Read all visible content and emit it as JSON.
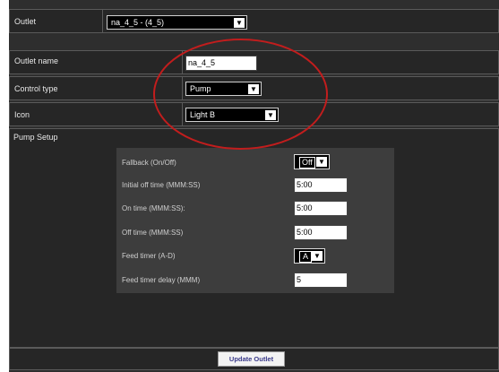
{
  "outlet": {
    "label": "Outlet",
    "selected": "na_4_5 - (4_5)"
  },
  "outlet_name": {
    "label": "Outlet name",
    "value": "na_4_5"
  },
  "control_type": {
    "label": "Control type",
    "selected": "Pump"
  },
  "icon": {
    "label": "Icon",
    "selected": "Light B"
  },
  "pump_setup": {
    "label": "Pump Setup",
    "fallback": {
      "label": "Fallback (On/Off)",
      "selected": "Off"
    },
    "initial_off_time": {
      "label": "Initial off time (MMM:SS)",
      "value": "5:00"
    },
    "on_time": {
      "label": "On time (MMM:SS):",
      "value": "5:00"
    },
    "off_time": {
      "label": "Off time (MMM:SS)",
      "value": "5:00"
    },
    "feed_timer": {
      "label": "Feed timer (A-D)",
      "selected": "A"
    },
    "feed_timer_delay": {
      "label": "Feed timer delay (MMM)",
      "value": "5"
    }
  },
  "update_button": {
    "label": "Update Outlet"
  },
  "annotation_color": "#c21d1d"
}
